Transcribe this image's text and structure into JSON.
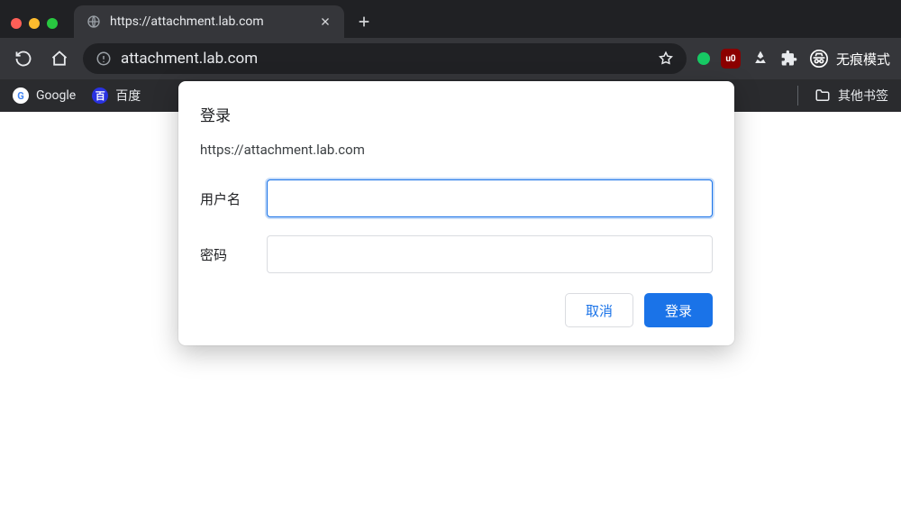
{
  "tab": {
    "title": "https://attachment.lab.com"
  },
  "omnibox": {
    "url": "attachment.lab.com"
  },
  "incognito": {
    "label": "无痕模式"
  },
  "bookmarks": {
    "google": "Google",
    "baidu": "百度",
    "other": "其他书签"
  },
  "dialog": {
    "title": "登录",
    "origin": "https://attachment.lab.com",
    "username_label": "用户名",
    "password_label": "密码",
    "username_value": "",
    "password_value": "",
    "cancel": "取消",
    "submit": "登录"
  }
}
